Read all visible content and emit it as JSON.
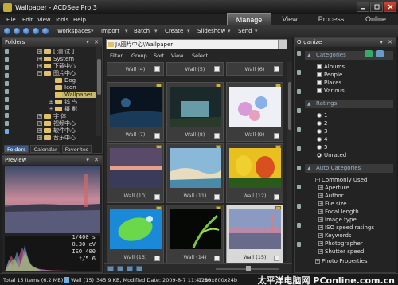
{
  "window": {
    "title": "Wallpaper - ACDSee Pro 3"
  },
  "menu": [
    "File",
    "Edit",
    "View",
    "Tools",
    "Help"
  ],
  "modes": [
    "Manage",
    "View",
    "Process",
    "Online"
  ],
  "toolbar": [
    "Workspaces",
    "Import",
    "Batch",
    "Create",
    "Slideshow",
    "Send"
  ],
  "folders": {
    "title": "Folders",
    "tree": [
      "[ 测 试 ]",
      "System",
      "下载中心",
      "图片中心",
      "Dog",
      "Icon",
      "Wallpaper",
      "钱 鸟",
      "摄 影",
      "字 体",
      "视频中心",
      "软件中心",
      "音乐中心"
    ],
    "tabs": [
      "Folders",
      "Calendar",
      "Favorites"
    ]
  },
  "preview": {
    "title": "Preview",
    "exif": [
      "1/400 s",
      "0.30 eV",
      "ISO 400",
      "f/5.6"
    ]
  },
  "browser": {
    "path": "J:\\图片中心\\Wallpaper",
    "filters": [
      "Filter",
      "Group",
      "Sort",
      "View",
      "Select"
    ],
    "top_captions": [
      "Wall (4)",
      "Wall (5)",
      "Wall (6)"
    ],
    "items": [
      "Wall (7)",
      "Wall (8)",
      "Wall (9)",
      "Wall (10)",
      "Wall (11)",
      "Wall (12)",
      "Wall (13)",
      "Wall (14)",
      "Wall (15)"
    ]
  },
  "organize": {
    "title": "Organize",
    "categories_header": "Categories",
    "categories": [
      "Albums",
      "People",
      "Places",
      "Various"
    ],
    "ratings_header": "Ratings",
    "ratings": [
      "1",
      "2",
      "3",
      "4",
      "5",
      "Unrated"
    ],
    "auto_header": "Auto Categories",
    "common_used": "Commonly Used",
    "auto_items": [
      "Aperture",
      "Author",
      "File size",
      "Focal length",
      "Image type",
      "ISO speed ratings",
      "Keywords",
      "Photographer",
      "Shutter speed"
    ],
    "photo_properties": "Photo Properties"
  },
  "status": {
    "total": "Total 15 items  (6.2 MB)",
    "current": "Wall (15)",
    "info": "345.9 KB, Modified Date: 2009-8-7 11:47:56",
    "dims": "1280x800x24b",
    "watermark": "太平洋电脑网 PConline.com.cn"
  },
  "colors": {
    "accent": "#3a5a8a",
    "folder": "#e2c067",
    "selection": "#c9b76a"
  }
}
